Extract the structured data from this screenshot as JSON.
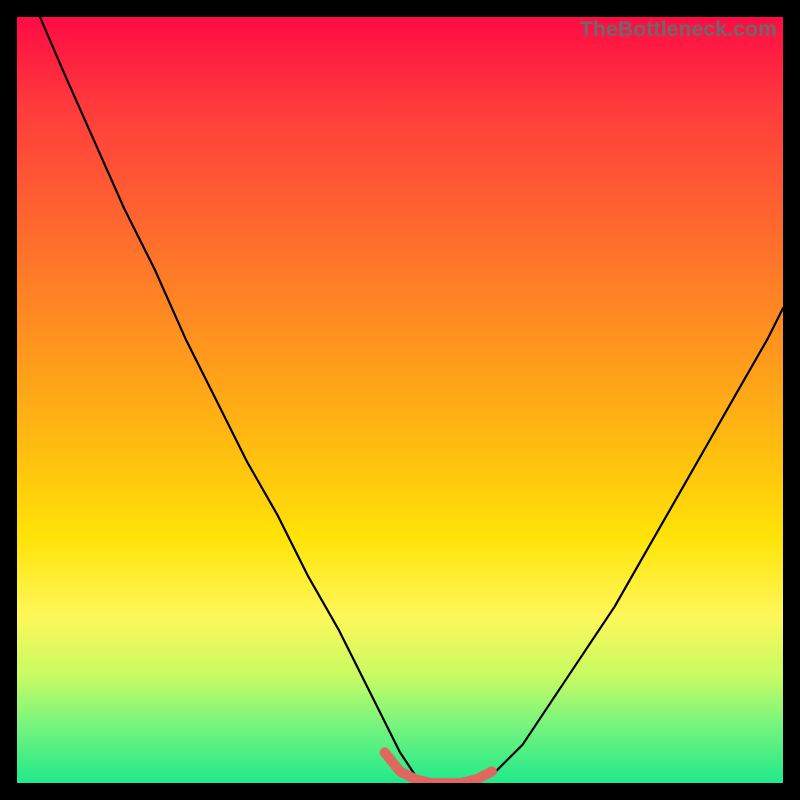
{
  "watermark": "TheBottleneck.com",
  "colors": {
    "frame": "#000000",
    "gradient_stops": [
      "#ff0b44",
      "#ff3c3c",
      "#ff6a2d",
      "#ff931f",
      "#ffbc10",
      "#ffe308",
      "#fff75a",
      "#c8fb63",
      "#7cf57c",
      "#20e98b"
    ],
    "curve": "#000000",
    "marker": "#e06660"
  },
  "chart_data": {
    "type": "line",
    "title": "",
    "xlabel": "",
    "ylabel": "",
    "xlim": [
      0,
      100
    ],
    "ylim": [
      0,
      100
    ],
    "series": [
      {
        "name": "bottleneck-curve",
        "x": [
          3,
          6,
          10,
          14,
          18,
          22,
          26,
          30,
          34,
          38,
          42,
          46,
          48,
          50,
          52,
          54,
          56,
          58,
          60,
          62,
          66,
          70,
          74,
          78,
          82,
          86,
          90,
          94,
          98,
          100
        ],
        "y": [
          100,
          93,
          84,
          75,
          67,
          58,
          50,
          42,
          35,
          27,
          20,
          12,
          8,
          4,
          1,
          0,
          0,
          0,
          0,
          1,
          5,
          11,
          17,
          23,
          30,
          37,
          44,
          51,
          58,
          62
        ]
      },
      {
        "name": "optimal-marker-segment",
        "x": [
          48,
          50,
          52,
          54,
          56,
          58,
          60,
          62
        ],
        "y": [
          4,
          1.5,
          0.5,
          0,
          0,
          0,
          0.5,
          1.5
        ]
      }
    ],
    "annotations": []
  }
}
